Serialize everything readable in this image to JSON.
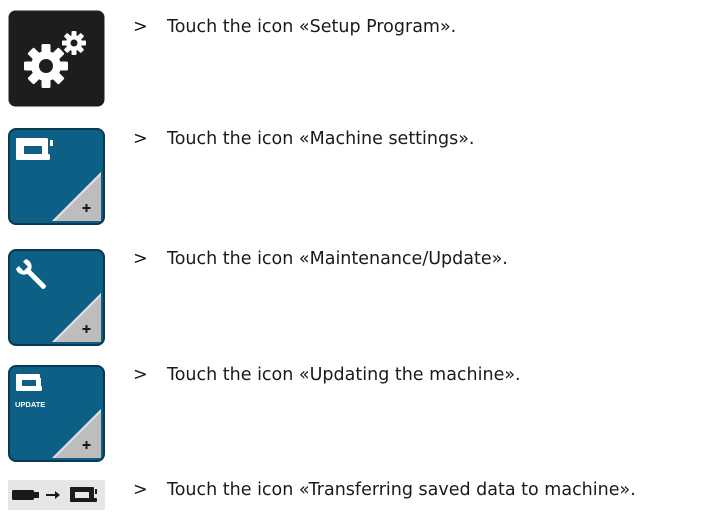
{
  "steps": [
    {
      "marker": ">",
      "text": "Touch the icon «Setup Program».",
      "icon": "setup-program-icon"
    },
    {
      "marker": ">",
      "text": "Touch the icon «Machine settings».",
      "icon": "machine-settings-icon"
    },
    {
      "marker": ">",
      "text": "Touch the icon «Maintenance/Update».",
      "icon": "maintenance-update-icon"
    },
    {
      "marker": ">",
      "text": "Touch the icon «Updating the machine».",
      "icon": "updating-machine-icon",
      "tile_label": "UPDATE"
    },
    {
      "marker": ">",
      "text": "Touch the icon «Transferring saved data to machine».",
      "icon": "transfer-data-to-machine-icon"
    }
  ],
  "colors": {
    "setup_tile": "#1d1d1d",
    "blue_tile": "#0d5f86",
    "tile_border": "#0a3a52",
    "corner_gray": "#bdbdbd",
    "icon_white": "#ffffff",
    "text": "#1a1a1a"
  }
}
